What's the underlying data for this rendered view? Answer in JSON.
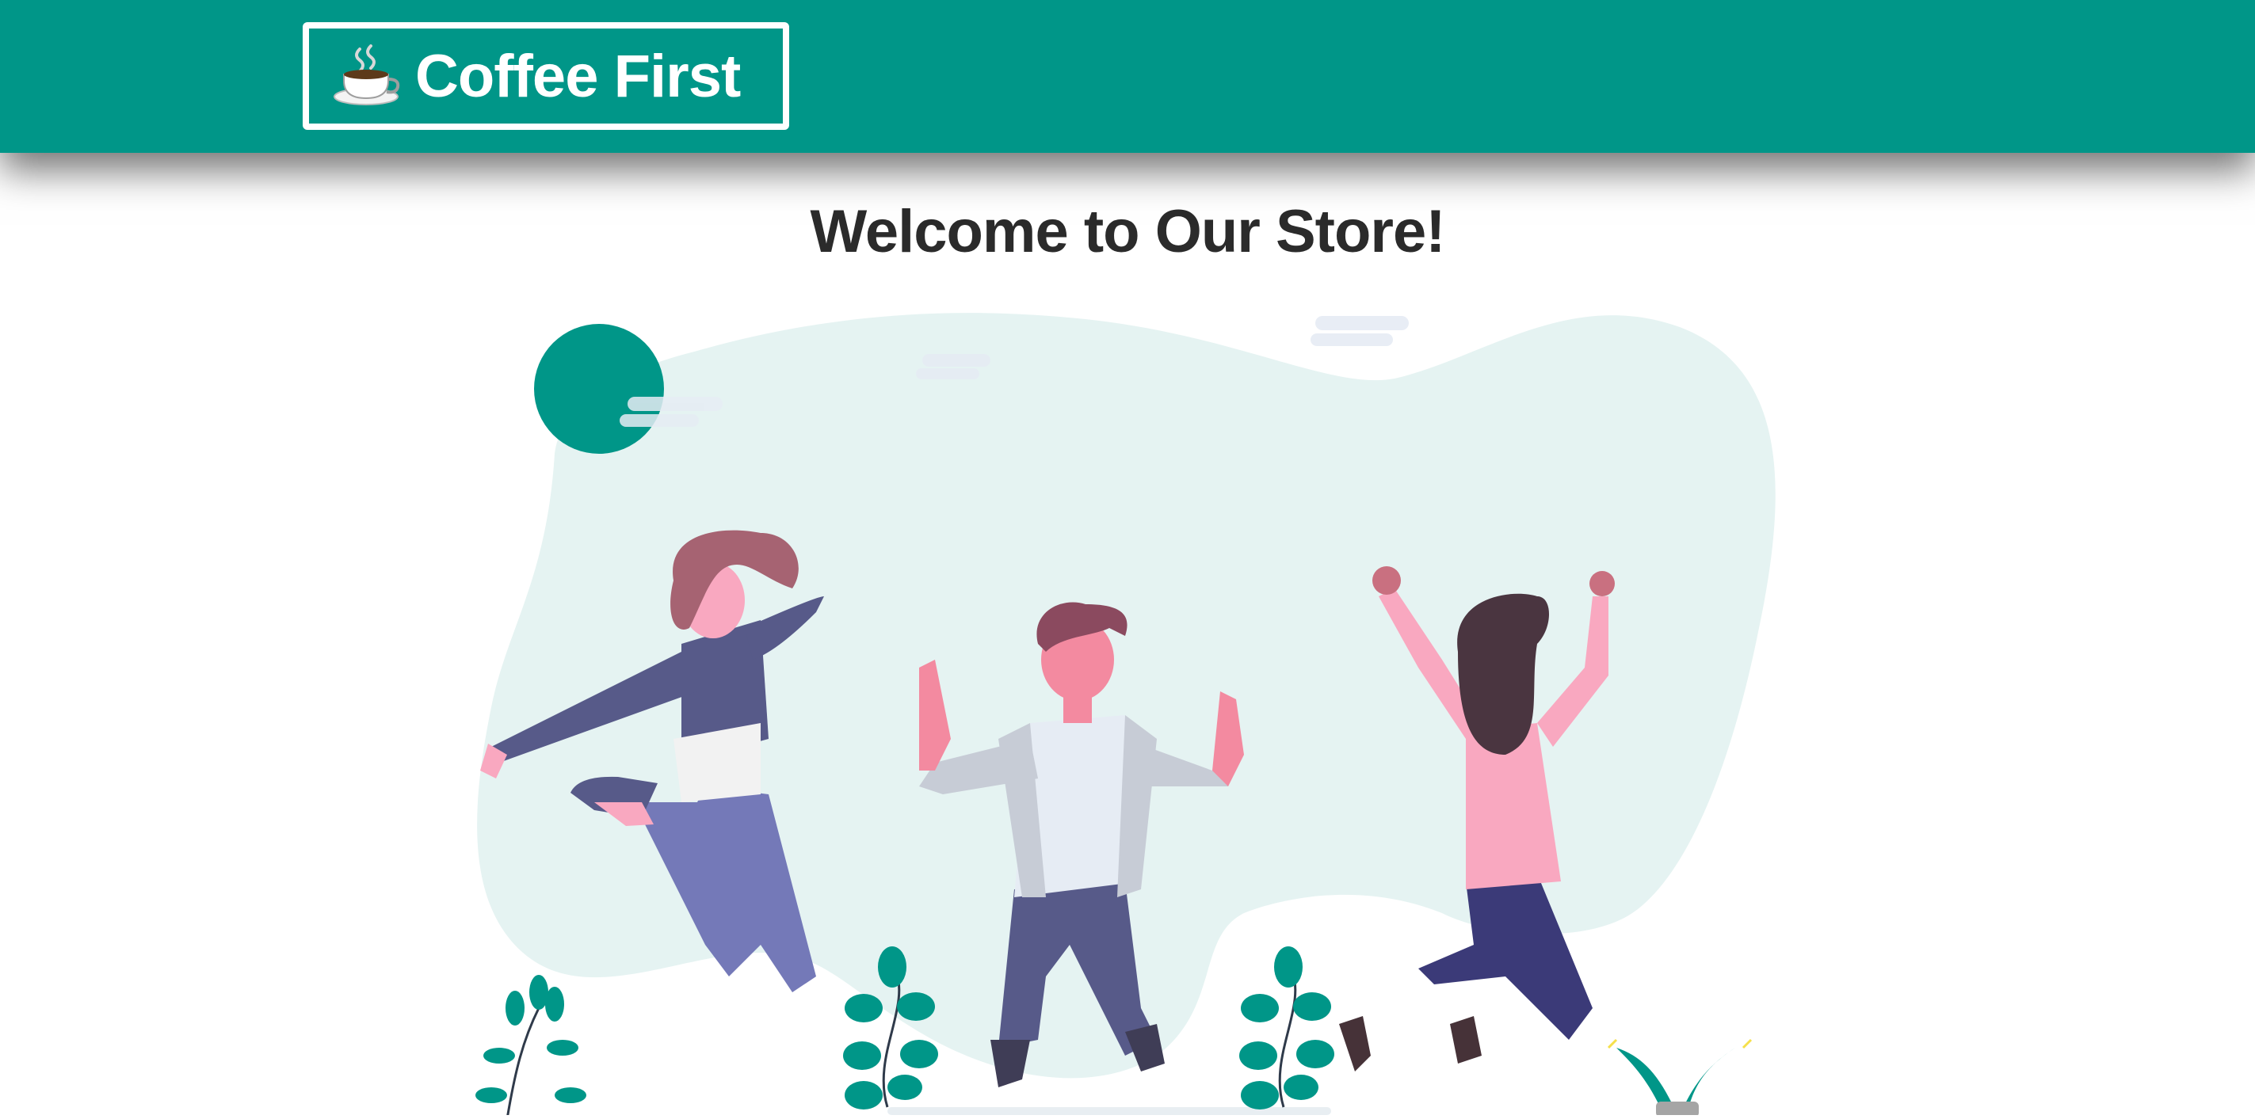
{
  "navbar": {
    "brand_label": "Coffee First",
    "brand_icon": "coffee-cup-icon",
    "color": "#009688"
  },
  "main": {
    "title": "Welcome to Our Store!"
  },
  "hero": {
    "illustration": "people-jumping-celebration",
    "accent_color": "#009688",
    "blob_color": "#e5f3f2"
  }
}
